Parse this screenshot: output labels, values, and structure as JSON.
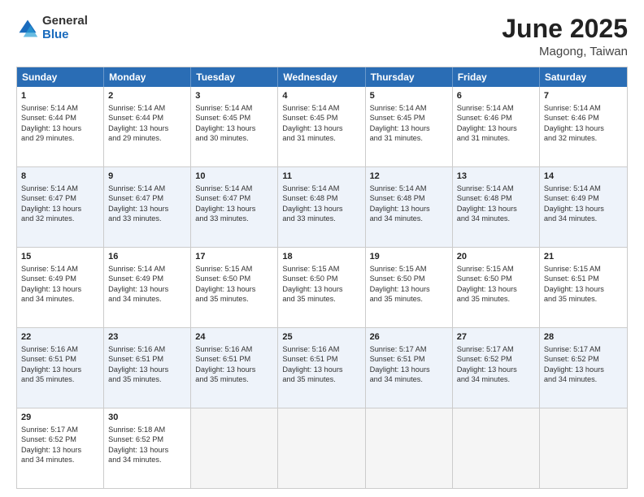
{
  "logo": {
    "general": "General",
    "blue": "Blue"
  },
  "title": {
    "month": "June 2025",
    "location": "Magong, Taiwan"
  },
  "header_days": [
    "Sunday",
    "Monday",
    "Tuesday",
    "Wednesday",
    "Thursday",
    "Friday",
    "Saturday"
  ],
  "weeks": [
    {
      "alt": false,
      "days": [
        {
          "num": "1",
          "lines": [
            "Sunrise: 5:14 AM",
            "Sunset: 6:44 PM",
            "Daylight: 13 hours",
            "and 29 minutes."
          ]
        },
        {
          "num": "2",
          "lines": [
            "Sunrise: 5:14 AM",
            "Sunset: 6:44 PM",
            "Daylight: 13 hours",
            "and 29 minutes."
          ]
        },
        {
          "num": "3",
          "lines": [
            "Sunrise: 5:14 AM",
            "Sunset: 6:45 PM",
            "Daylight: 13 hours",
            "and 30 minutes."
          ]
        },
        {
          "num": "4",
          "lines": [
            "Sunrise: 5:14 AM",
            "Sunset: 6:45 PM",
            "Daylight: 13 hours",
            "and 31 minutes."
          ]
        },
        {
          "num": "5",
          "lines": [
            "Sunrise: 5:14 AM",
            "Sunset: 6:45 PM",
            "Daylight: 13 hours",
            "and 31 minutes."
          ]
        },
        {
          "num": "6",
          "lines": [
            "Sunrise: 5:14 AM",
            "Sunset: 6:46 PM",
            "Daylight: 13 hours",
            "and 31 minutes."
          ]
        },
        {
          "num": "7",
          "lines": [
            "Sunrise: 5:14 AM",
            "Sunset: 6:46 PM",
            "Daylight: 13 hours",
            "and 32 minutes."
          ]
        }
      ]
    },
    {
      "alt": true,
      "days": [
        {
          "num": "8",
          "lines": [
            "Sunrise: 5:14 AM",
            "Sunset: 6:47 PM",
            "Daylight: 13 hours",
            "and 32 minutes."
          ]
        },
        {
          "num": "9",
          "lines": [
            "Sunrise: 5:14 AM",
            "Sunset: 6:47 PM",
            "Daylight: 13 hours",
            "and 33 minutes."
          ]
        },
        {
          "num": "10",
          "lines": [
            "Sunrise: 5:14 AM",
            "Sunset: 6:47 PM",
            "Daylight: 13 hours",
            "and 33 minutes."
          ]
        },
        {
          "num": "11",
          "lines": [
            "Sunrise: 5:14 AM",
            "Sunset: 6:48 PM",
            "Daylight: 13 hours",
            "and 33 minutes."
          ]
        },
        {
          "num": "12",
          "lines": [
            "Sunrise: 5:14 AM",
            "Sunset: 6:48 PM",
            "Daylight: 13 hours",
            "and 34 minutes."
          ]
        },
        {
          "num": "13",
          "lines": [
            "Sunrise: 5:14 AM",
            "Sunset: 6:48 PM",
            "Daylight: 13 hours",
            "and 34 minutes."
          ]
        },
        {
          "num": "14",
          "lines": [
            "Sunrise: 5:14 AM",
            "Sunset: 6:49 PM",
            "Daylight: 13 hours",
            "and 34 minutes."
          ]
        }
      ]
    },
    {
      "alt": false,
      "days": [
        {
          "num": "15",
          "lines": [
            "Sunrise: 5:14 AM",
            "Sunset: 6:49 PM",
            "Daylight: 13 hours",
            "and 34 minutes."
          ]
        },
        {
          "num": "16",
          "lines": [
            "Sunrise: 5:14 AM",
            "Sunset: 6:49 PM",
            "Daylight: 13 hours",
            "and 34 minutes."
          ]
        },
        {
          "num": "17",
          "lines": [
            "Sunrise: 5:15 AM",
            "Sunset: 6:50 PM",
            "Daylight: 13 hours",
            "and 35 minutes."
          ]
        },
        {
          "num": "18",
          "lines": [
            "Sunrise: 5:15 AM",
            "Sunset: 6:50 PM",
            "Daylight: 13 hours",
            "and 35 minutes."
          ]
        },
        {
          "num": "19",
          "lines": [
            "Sunrise: 5:15 AM",
            "Sunset: 6:50 PM",
            "Daylight: 13 hours",
            "and 35 minutes."
          ]
        },
        {
          "num": "20",
          "lines": [
            "Sunrise: 5:15 AM",
            "Sunset: 6:50 PM",
            "Daylight: 13 hours",
            "and 35 minutes."
          ]
        },
        {
          "num": "21",
          "lines": [
            "Sunrise: 5:15 AM",
            "Sunset: 6:51 PM",
            "Daylight: 13 hours",
            "and 35 minutes."
          ]
        }
      ]
    },
    {
      "alt": true,
      "days": [
        {
          "num": "22",
          "lines": [
            "Sunrise: 5:16 AM",
            "Sunset: 6:51 PM",
            "Daylight: 13 hours",
            "and 35 minutes."
          ]
        },
        {
          "num": "23",
          "lines": [
            "Sunrise: 5:16 AM",
            "Sunset: 6:51 PM",
            "Daylight: 13 hours",
            "and 35 minutes."
          ]
        },
        {
          "num": "24",
          "lines": [
            "Sunrise: 5:16 AM",
            "Sunset: 6:51 PM",
            "Daylight: 13 hours",
            "and 35 minutes."
          ]
        },
        {
          "num": "25",
          "lines": [
            "Sunrise: 5:16 AM",
            "Sunset: 6:51 PM",
            "Daylight: 13 hours",
            "and 35 minutes."
          ]
        },
        {
          "num": "26",
          "lines": [
            "Sunrise: 5:17 AM",
            "Sunset: 6:51 PM",
            "Daylight: 13 hours",
            "and 34 minutes."
          ]
        },
        {
          "num": "27",
          "lines": [
            "Sunrise: 5:17 AM",
            "Sunset: 6:52 PM",
            "Daylight: 13 hours",
            "and 34 minutes."
          ]
        },
        {
          "num": "28",
          "lines": [
            "Sunrise: 5:17 AM",
            "Sunset: 6:52 PM",
            "Daylight: 13 hours",
            "and 34 minutes."
          ]
        }
      ]
    },
    {
      "alt": false,
      "days": [
        {
          "num": "29",
          "lines": [
            "Sunrise: 5:17 AM",
            "Sunset: 6:52 PM",
            "Daylight: 13 hours",
            "and 34 minutes."
          ]
        },
        {
          "num": "30",
          "lines": [
            "Sunrise: 5:18 AM",
            "Sunset: 6:52 PM",
            "Daylight: 13 hours",
            "and 34 minutes."
          ]
        },
        {
          "num": "",
          "lines": []
        },
        {
          "num": "",
          "lines": []
        },
        {
          "num": "",
          "lines": []
        },
        {
          "num": "",
          "lines": []
        },
        {
          "num": "",
          "lines": []
        }
      ]
    }
  ]
}
